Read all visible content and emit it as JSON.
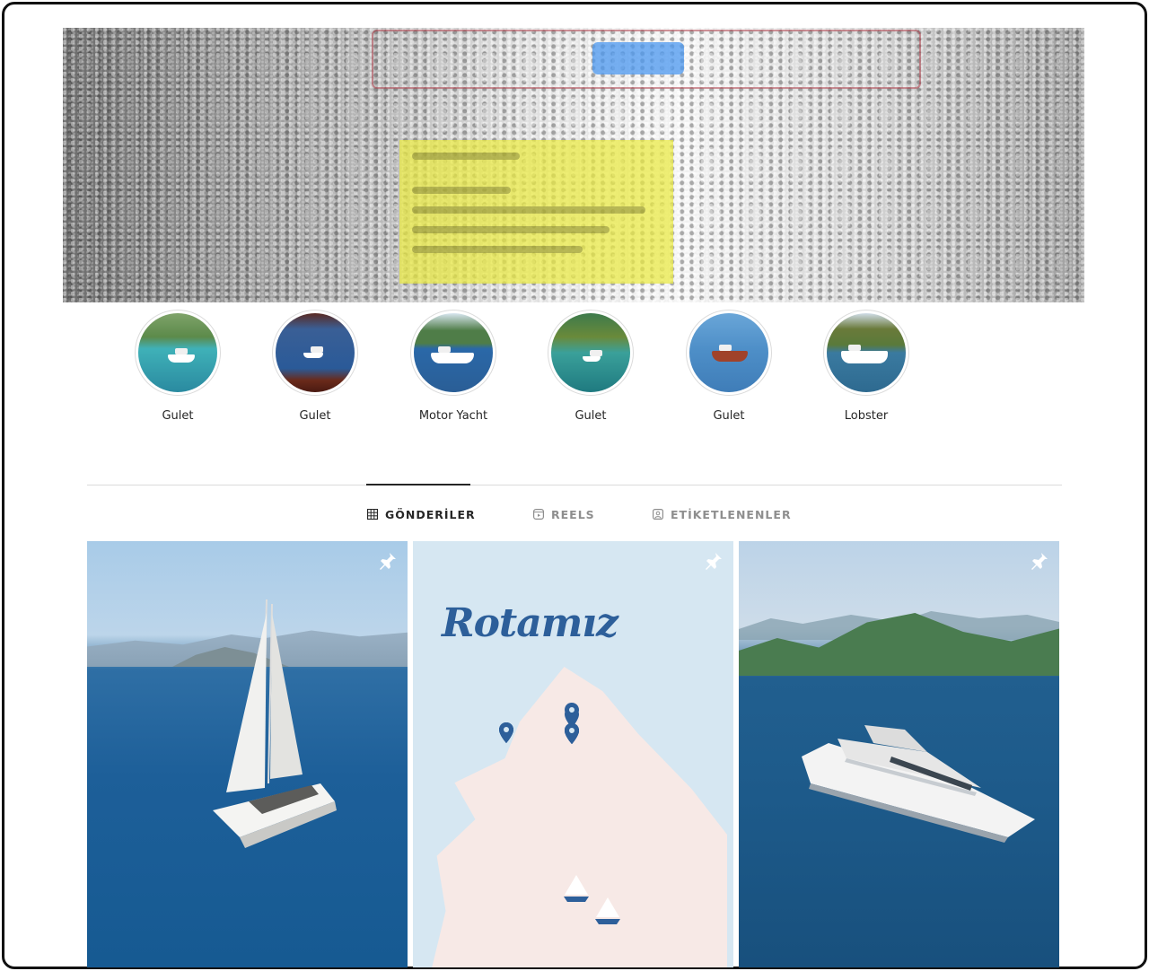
{
  "highlights": [
    {
      "label": "Gulet"
    },
    {
      "label": "Gulet"
    },
    {
      "label": "Motor Yacht"
    },
    {
      "label": "Gulet"
    },
    {
      "label": "Gulet"
    },
    {
      "label": "Lobster"
    }
  ],
  "tabs": [
    {
      "label": "GÖNDERİLER",
      "icon": "grid-icon",
      "active": true
    },
    {
      "label": "REELS",
      "icon": "reels-icon",
      "active": false
    },
    {
      "label": "ETİKETLENENLER",
      "icon": "tagged-icon",
      "active": false
    }
  ],
  "posts": [
    {
      "kind": "photo",
      "subject": "catamaran",
      "pinned": true
    },
    {
      "kind": "map",
      "title": "Rotamız",
      "pinned": true
    },
    {
      "kind": "photo",
      "subject": "motor yacht",
      "pinned": true
    }
  ],
  "colors": {
    "map_blue": "#2d5f9a",
    "sea": "#1d5f99",
    "tab_active": "#262626",
    "tab_inactive": "#8e8e8e"
  }
}
